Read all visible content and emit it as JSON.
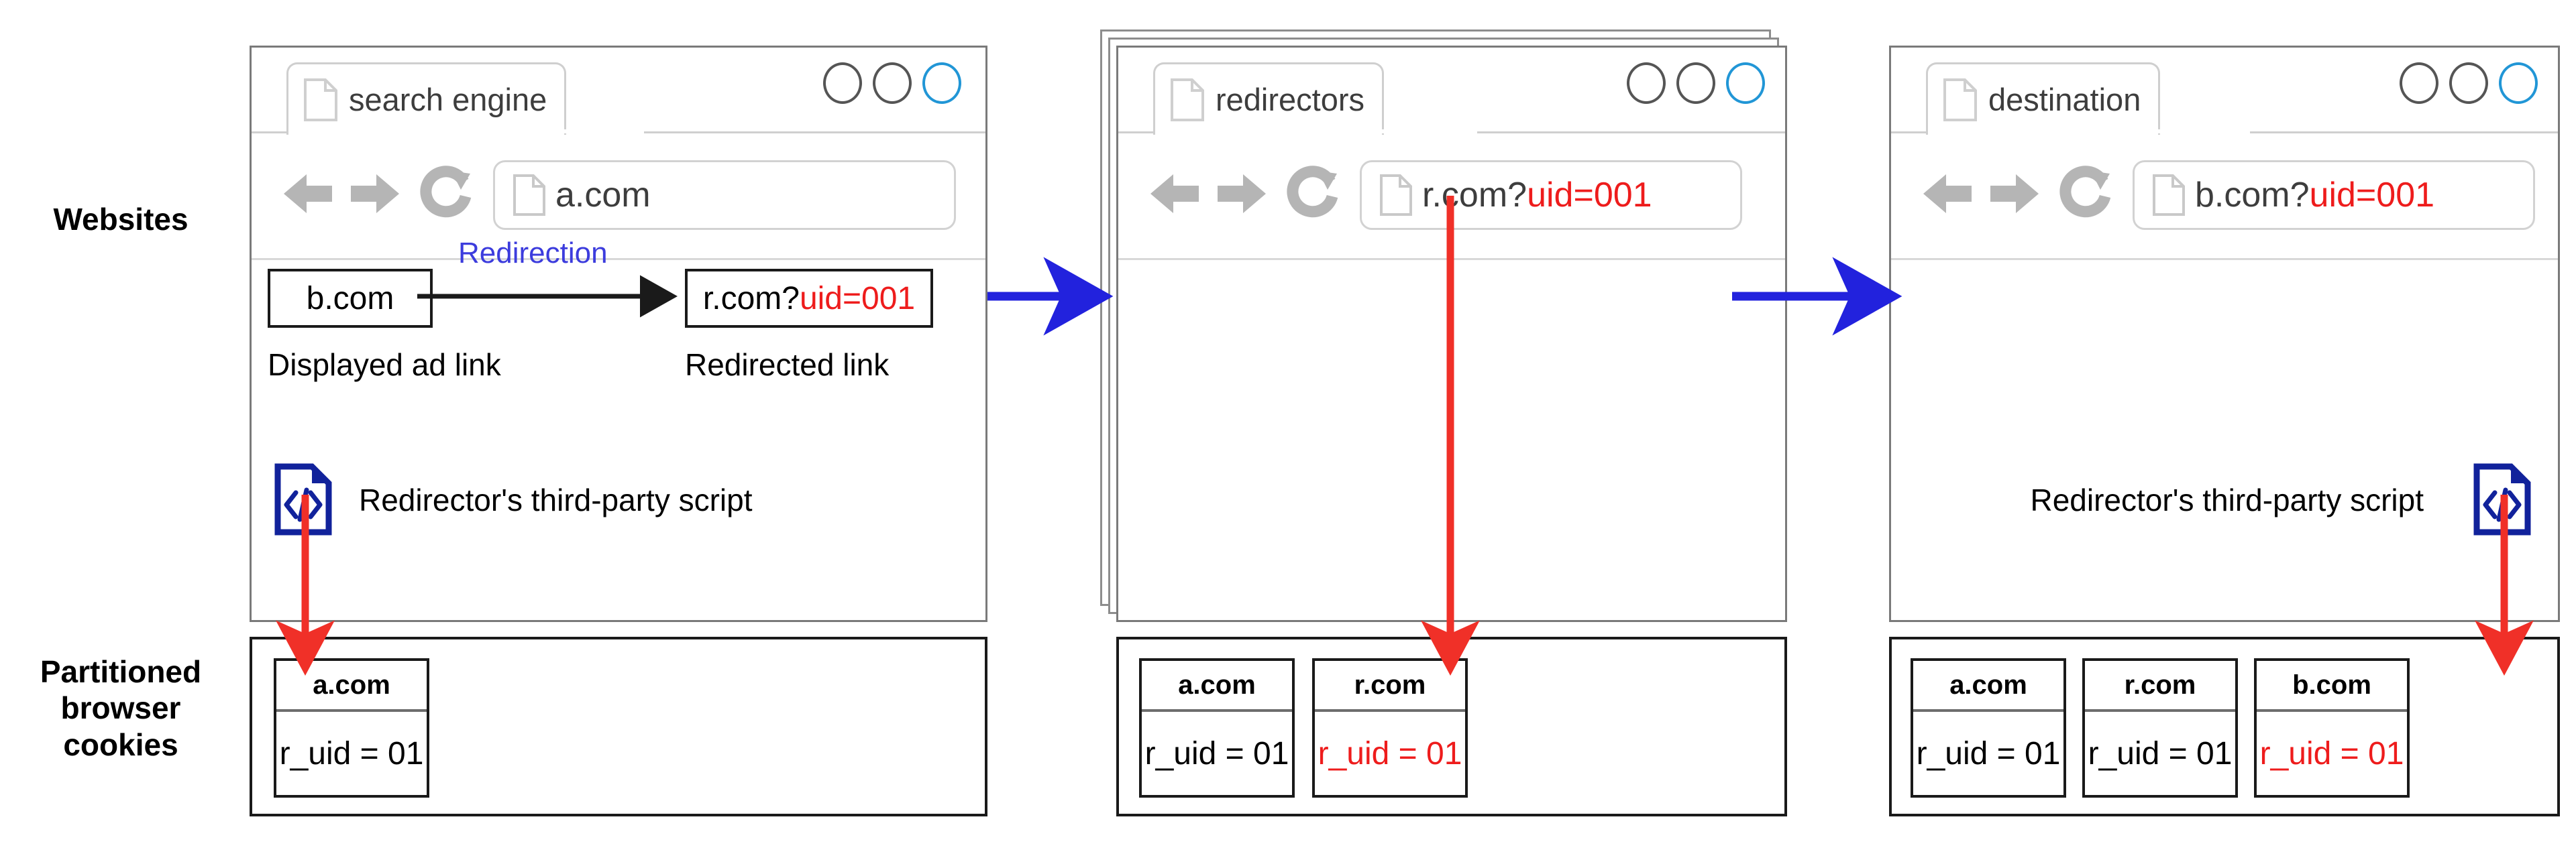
{
  "row_labels": {
    "websites": "Websites",
    "cookies_line1": "Partitioned",
    "cookies_line2": "browser",
    "cookies_line3": "cookies"
  },
  "panels": [
    {
      "id": "search-engine",
      "tab_title": "search engine",
      "url_prefix": "a.com",
      "url_uid": "",
      "stacked": false,
      "script_label": "Redirector's third-party script",
      "script_icon": "code-document-icon",
      "script_side": "left",
      "links": {
        "displayed": "b.com",
        "displayed_caption": "Displayed ad link",
        "redirected_prefix": "r.com?",
        "redirected_uid": "uid=001",
        "redirected_caption": "Redirected link",
        "redirection_label": "Redirection"
      },
      "cookies": [
        {
          "domain": "a.com",
          "value": "r_uid = 01",
          "highlight": false
        }
      ]
    },
    {
      "id": "redirectors",
      "tab_title": "redirectors",
      "url_prefix": "r.com?",
      "url_uid": "uid=001",
      "stacked": true,
      "script_label": "",
      "script_icon": "",
      "script_side": "",
      "links": null,
      "cookies": [
        {
          "domain": "a.com",
          "value": "r_uid = 01",
          "highlight": false
        },
        {
          "domain": "r.com",
          "value": "r_uid = 01",
          "highlight": true
        }
      ]
    },
    {
      "id": "destination",
      "tab_title": "destination",
      "url_prefix": "b.com?",
      "url_uid": "uid=001",
      "stacked": false,
      "script_label": "Redirector's third-party script",
      "script_icon": "code-document-icon",
      "script_side": "right",
      "links": null,
      "cookies": [
        {
          "domain": "a.com",
          "value": "r_uid = 01",
          "highlight": false
        },
        {
          "domain": "r.com",
          "value": "r_uid = 01",
          "highlight": false
        },
        {
          "domain": "b.com",
          "value": "r_uid = 01",
          "highlight": true
        }
      ]
    }
  ],
  "window_controls": {
    "icons": [
      "circle-button",
      "circle-button",
      "circle-button-active"
    ]
  },
  "nav_icons": [
    "back-arrow-icon",
    "forward-arrow-icon",
    "reload-icon"
  ],
  "colors": {
    "uid_red": "#ee1c1c",
    "redirection_blue": "#3c3cdd",
    "flow_arrow_blue": "#2222dd",
    "cookie_arrow_red": "#f03028",
    "script_icon_navy": "#11229b",
    "window_btn_active": "#2196d6",
    "chrome_gray": "#7a7a7a"
  },
  "flow_arrows": [
    {
      "name": "search-engine-to-redirectors",
      "color": "#2222dd",
      "direction": "right"
    },
    {
      "name": "redirectors-to-destination",
      "color": "#2222dd",
      "direction": "right"
    }
  ],
  "cookie_arrows": [
    {
      "name": "script-to-a-com-cookie",
      "color": "#f03028",
      "direction": "down"
    },
    {
      "name": "url-to-r-com-cookie",
      "color": "#f03028",
      "direction": "down"
    },
    {
      "name": "script-to-b-com-cookie",
      "color": "#f03028",
      "direction": "down"
    }
  ]
}
